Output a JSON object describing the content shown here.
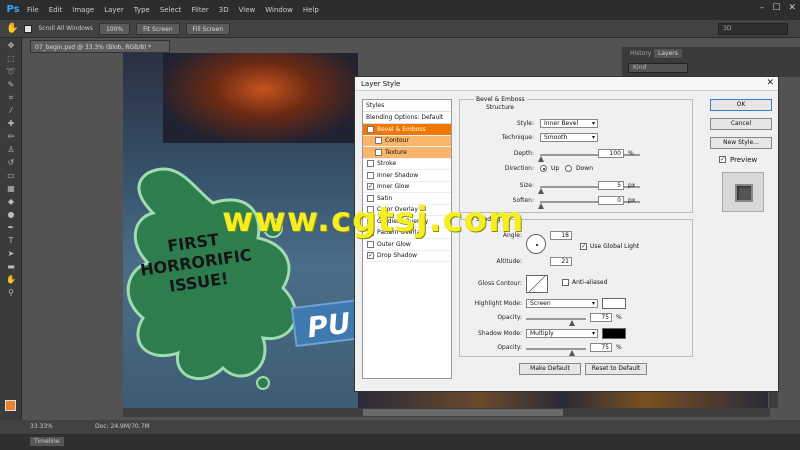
{
  "app": {
    "logo": "Ps"
  },
  "menu": [
    "File",
    "Edit",
    "Image",
    "Layer",
    "Type",
    "Select",
    "Filter",
    "3D",
    "View",
    "Window",
    "Help"
  ],
  "window_controls": {
    "minimize": "–",
    "maximize": "☐",
    "close": "✕"
  },
  "options": {
    "scroll_all": "Scroll All Windows",
    "btn_100": "100%",
    "fit_screen": "Fit Screen",
    "fill_screen": "Fill Screen",
    "workspace": "3D"
  },
  "document": {
    "tab": "07_begin.psd @ 33.3% (Blob, RGB/8) *",
    "zoom": "33.33%",
    "doc_size": "Doc: 24.9M/70.7M"
  },
  "artwork": {
    "splat_line1": "FIRST",
    "splat_line2": "HORRORIFIC",
    "splat_line3": "ISSUE!",
    "plank_text": "PU"
  },
  "watermark": "www.cgtsj.com",
  "panels": {
    "tab_history": "History",
    "tab_layers": "Layers",
    "filter_kind": "Kind"
  },
  "timeline": "Timeline",
  "dialog": {
    "title": "Layer Style",
    "close": "✕",
    "styles_header": "Styles",
    "blending_options": "Blending Options: Default",
    "items": [
      {
        "label": "Bevel & Emboss",
        "checked": true
      },
      {
        "label": "Contour",
        "checked": false
      },
      {
        "label": "Texture",
        "checked": false
      },
      {
        "label": "Stroke",
        "checked": false
      },
      {
        "label": "Inner Shadow",
        "checked": false
      },
      {
        "label": "Inner Glow",
        "checked": true
      },
      {
        "label": "Satin",
        "checked": false
      },
      {
        "label": "Color Overlay",
        "checked": false
      },
      {
        "label": "Gradient Overlay",
        "checked": false
      },
      {
        "label": "Pattern Overlay",
        "checked": false
      },
      {
        "label": "Outer Glow",
        "checked": false
      },
      {
        "label": "Drop Shadow",
        "checked": true
      }
    ],
    "bevel": {
      "group_title": "Bevel & Emboss",
      "structure_title": "Structure",
      "style_label": "Style:",
      "style_value": "Inner Bevel",
      "technique_label": "Technique:",
      "technique_value": "Smooth",
      "depth_label": "Depth:",
      "depth_value": "100",
      "depth_unit": "%",
      "direction_label": "Direction:",
      "dir_up": "Up",
      "dir_down": "Down",
      "size_label": "Size:",
      "size_value": "5",
      "size_unit": "px",
      "soften_label": "Soften:",
      "soften_value": "0",
      "soften_unit": "px"
    },
    "shading": {
      "group_title": "Shading",
      "angle_label": "Angle:",
      "angle_value": "18",
      "global_light": "Use Global Light",
      "altitude_label": "Altitude:",
      "altitude_value": "21",
      "gloss_label": "Gloss Contour:",
      "anti_aliased": "Anti-aliased",
      "highlight_label": "Highlight Mode:",
      "highlight_value": "Screen",
      "hl_opacity_label": "Opacity:",
      "hl_opacity_value": "75",
      "hl_opacity_unit": "%",
      "shadow_label": "Shadow Mode:",
      "shadow_value": "Multiply",
      "sh_opacity_label": "Opacity:",
      "sh_opacity_value": "75",
      "sh_opacity_unit": "%",
      "highlight_color": "#ffffff",
      "shadow_color": "#000000"
    },
    "make_default": "Make Default",
    "reset_default": "Reset to Default",
    "ok": "OK",
    "cancel": "Cancel",
    "new_style": "New Style...",
    "preview": "Preview"
  }
}
